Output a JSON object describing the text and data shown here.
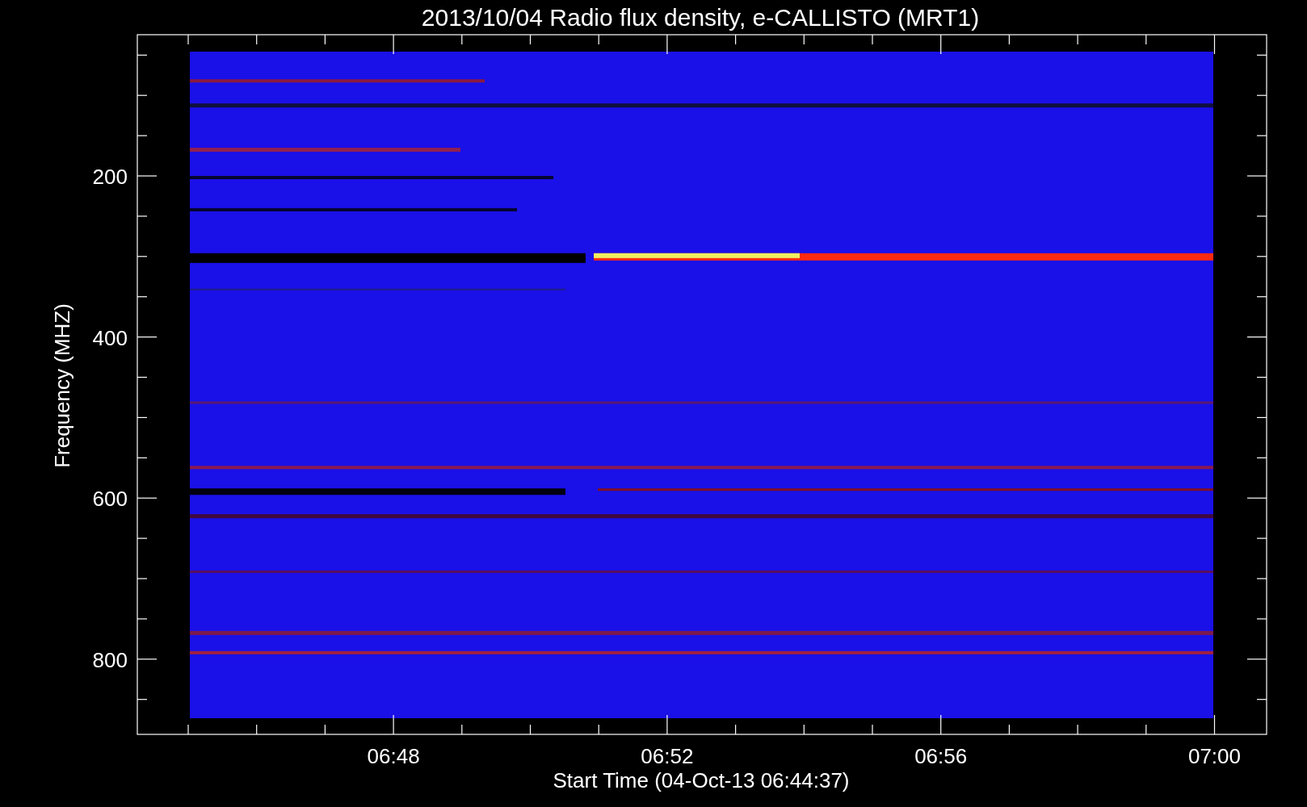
{
  "title": "2013/10/04  Radio flux density, e-CALLISTO (MRT1)",
  "plot": {
    "ylabel": "Frequency (MHZ)",
    "xlabel": "Start Time (04-Oct-13 06:44:37)",
    "yticks": [
      "200",
      "400",
      "600",
      "800"
    ],
    "xticks": [
      "06:48",
      "06:52",
      "06:56",
      "07:00"
    ]
  }
}
